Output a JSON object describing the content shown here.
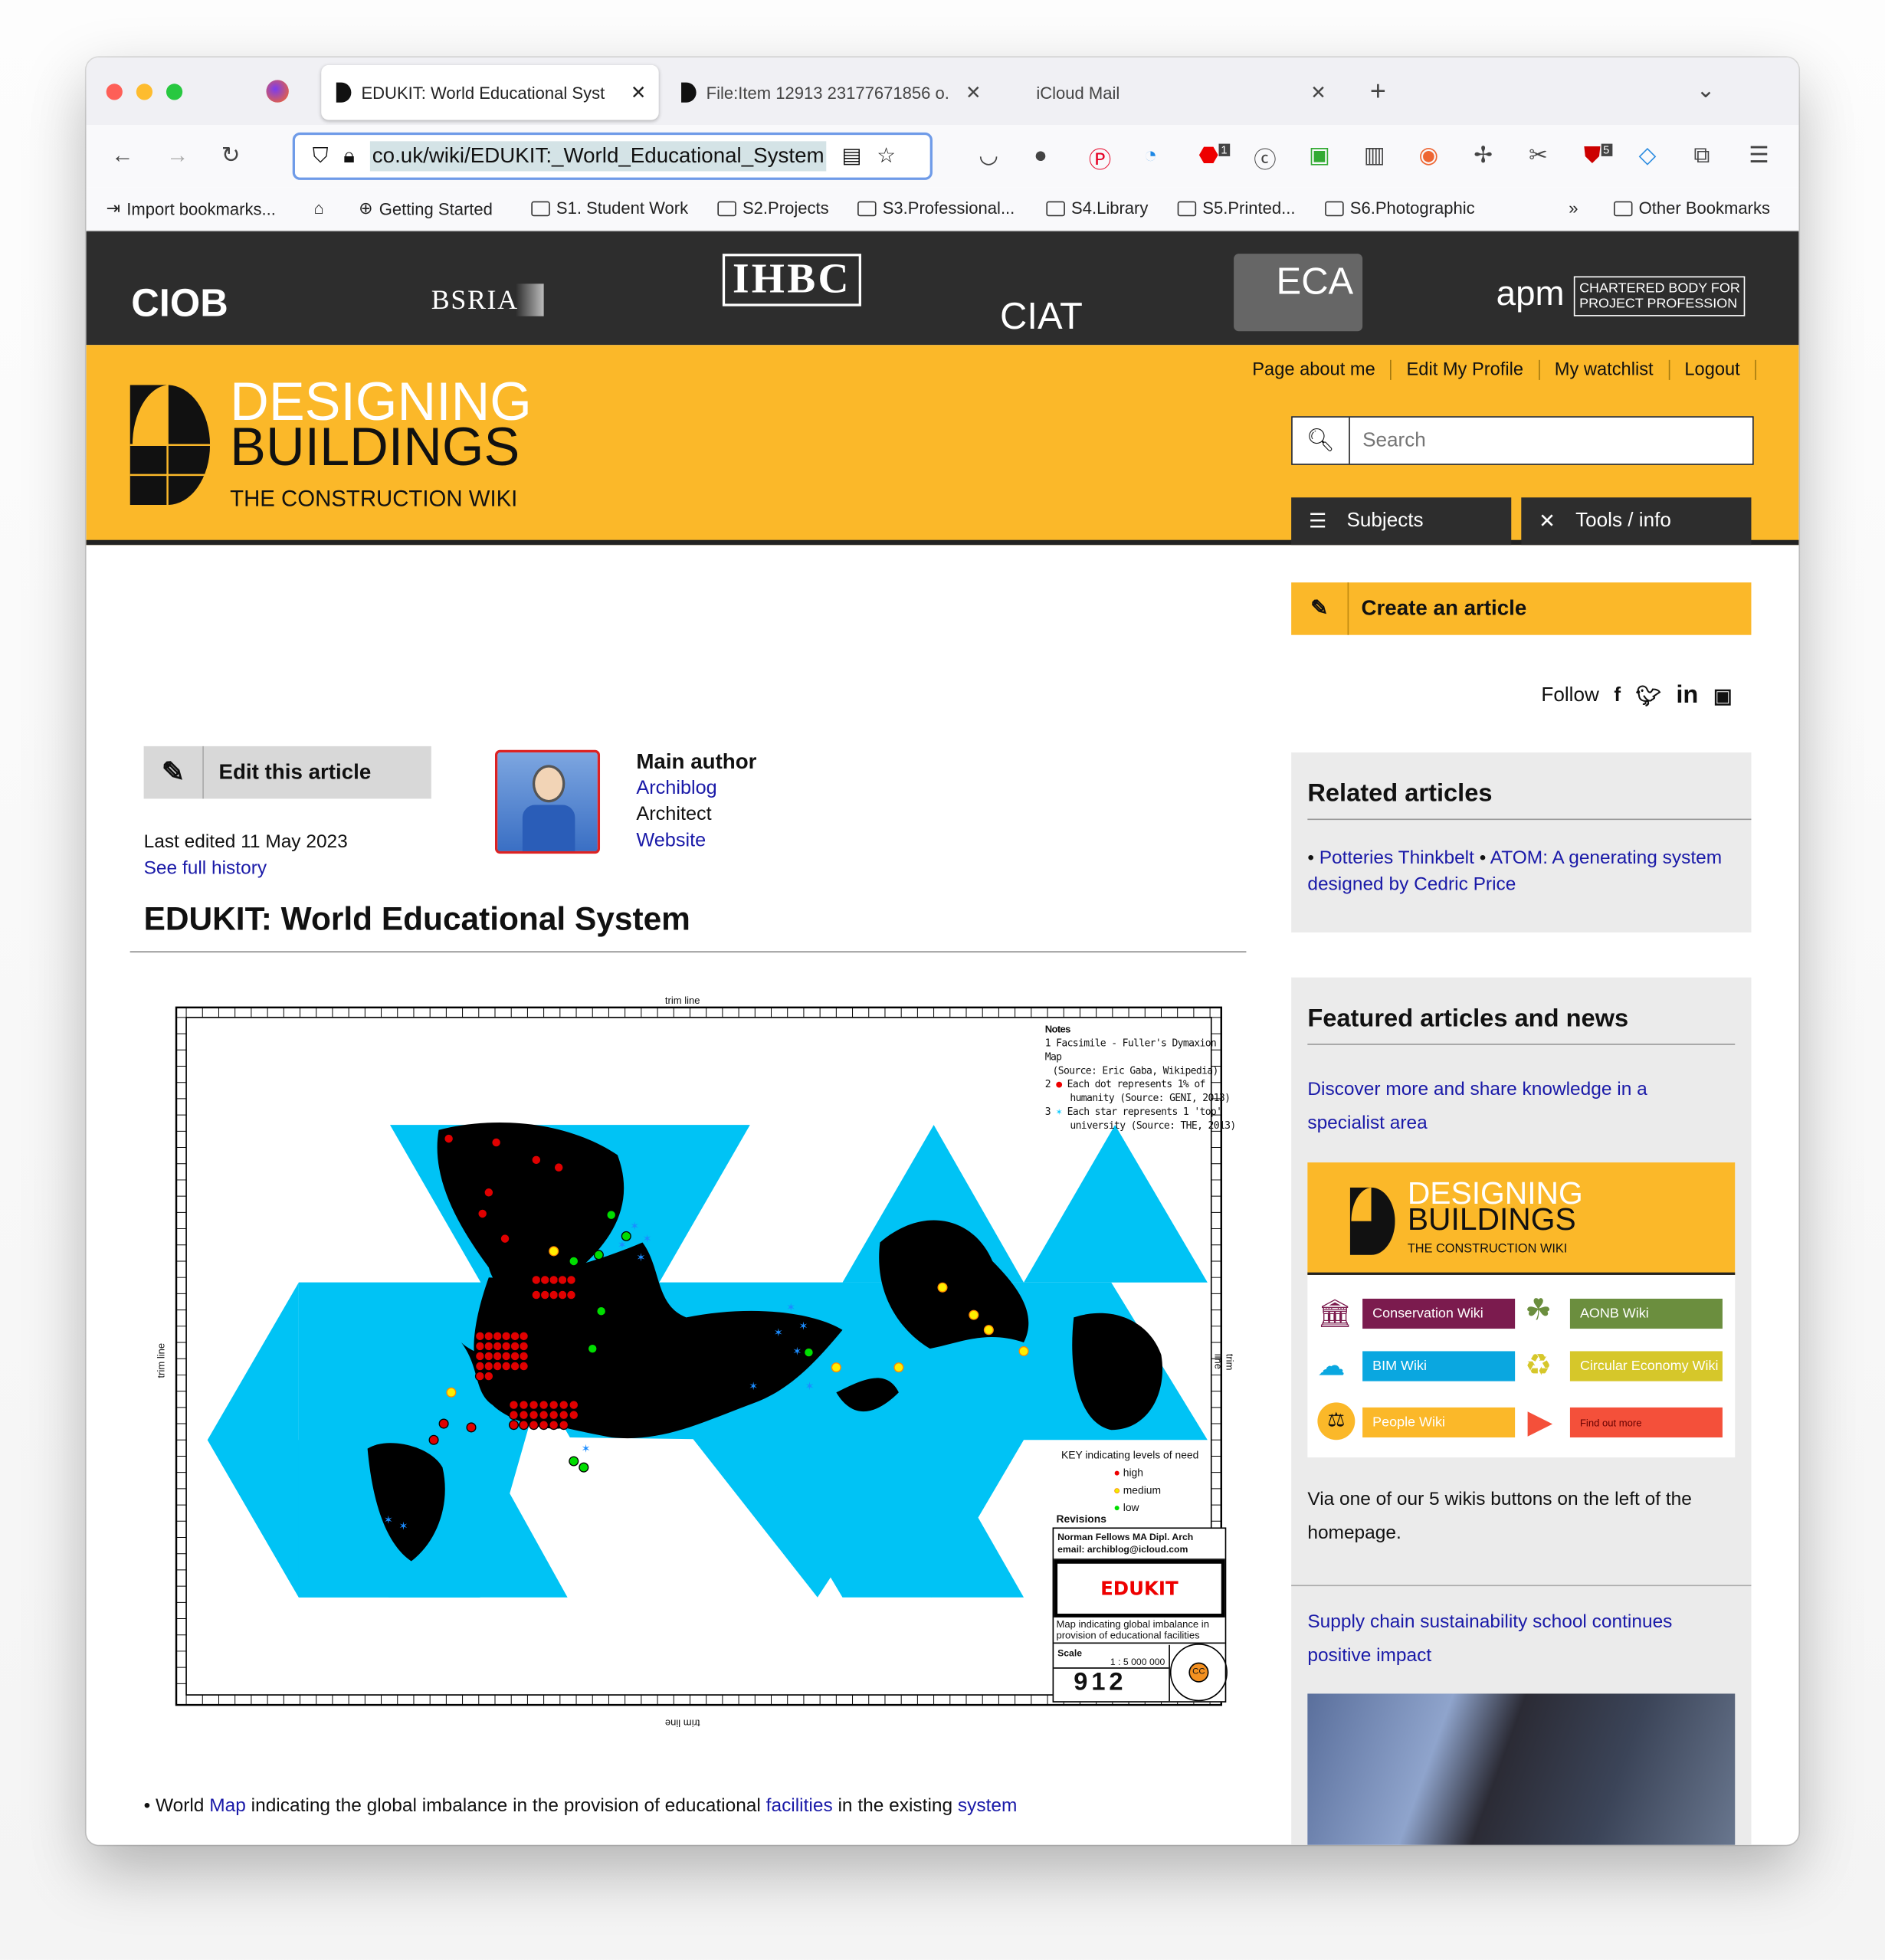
{
  "browser": {
    "tabs": [
      {
        "title": "EDUKIT: World Educational Syst",
        "active": true
      },
      {
        "title": "File:Item 12913 23177671856 o.",
        "active": false
      },
      {
        "title": "iCloud Mail",
        "active": false
      }
    ],
    "url": "co.uk/wiki/EDUKIT:_World_Educational_System",
    "badges": {
      "abp": "1",
      "ublock": "5"
    },
    "bookmarks": [
      "Import bookmarks...",
      "Getting Started",
      "S1. Student Work",
      "S2.Projects",
      "S3.Professional...",
      "S4.Library",
      "S5.Printed...",
      "S6.Photographic",
      "Other Bookmarks"
    ]
  },
  "partners": [
    "CIOB",
    "BSRIA",
    "IHBC",
    "CIAT",
    "ECA",
    "apm"
  ],
  "site": {
    "logo": {
      "line1": "DESIGNING",
      "line2": "BUILDINGS",
      "line3": "THE CONSTRUCTION WIKI"
    },
    "top_links": [
      "Page about me",
      "Edit My Profile",
      "My watchlist",
      "Logout"
    ],
    "search_placeholder": "Search",
    "nav": {
      "subjects": "Subjects",
      "tools": "Tools / info"
    },
    "create": "Create an article",
    "follow": "Follow",
    "accent": "#fbb829"
  },
  "article": {
    "edit": "Edit this article",
    "last_edited": "Last edited 11 May 2023",
    "history": "See full history",
    "author_heading": "Main author",
    "author_name": "Archiblog",
    "author_role": "Architect",
    "author_site": "Website",
    "title": "EDUKIT: World Educational System",
    "caption": {
      "p1": "• World ",
      "l1": "Map",
      "p2": " indicating the global imbalance in the provision of educational ",
      "l2": "facilities",
      "p3": " in the existing ",
      "l3": "system"
    }
  },
  "map": {
    "trim": "trim line",
    "notes_title": "Notes",
    "notes": [
      "1 Facsimile - Fuller's Dymaxion Map",
      "(Source: Eric Gaba, Wikipedia)",
      "Each dot represents 1% of",
      "humanity (Source: GENI, 2013)",
      "Each star represents 1 'top'",
      "university (Source: THE, 2013)"
    ],
    "key_title": "KEY  indicating levels of need",
    "key": [
      {
        "label": "high",
        "color": "#e00000"
      },
      {
        "label": "medium",
        "color": "#ffee00"
      },
      {
        "label": "low",
        "color": "#00dd00"
      }
    ],
    "revisions": "Revisions",
    "author": "Norman Fellows  MA Dipl. Arch",
    "email": "email:    archiblog@icloud.com",
    "project": "EDUKIT",
    "description": "Map indicating global imbalance in provision of educational facilities",
    "scale_label": "Scale",
    "scale": "1 : 5 000 000",
    "number": "912",
    "cc": "CC"
  },
  "sidebar": {
    "related_title": "Related articles",
    "related": [
      "Potteries Thinkbelt",
      "ATOM: A generating system designed by Cedric Price"
    ],
    "featured_title": "Featured articles and news",
    "featured1": "Discover more and share knowledge in a specialist area",
    "wikis": [
      {
        "label": "Conservation Wiki",
        "color": "#7b1b4e"
      },
      {
        "label": "AONB Wiki",
        "color": "#6b8e3e"
      },
      {
        "label": "BIM Wiki",
        "color": "#0aa7e0"
      },
      {
        "label": "Circular Economy Wiki",
        "color": "#d6c72a"
      },
      {
        "label": "People Wiki",
        "color": "#fbb829"
      },
      {
        "label": "Find out more",
        "color": "#f4503a"
      }
    ],
    "featured1_text": "Via one of our 5 wikis buttons on the left of the homepage.",
    "featured2": "Supply chain sustainability school continues positive impact"
  }
}
